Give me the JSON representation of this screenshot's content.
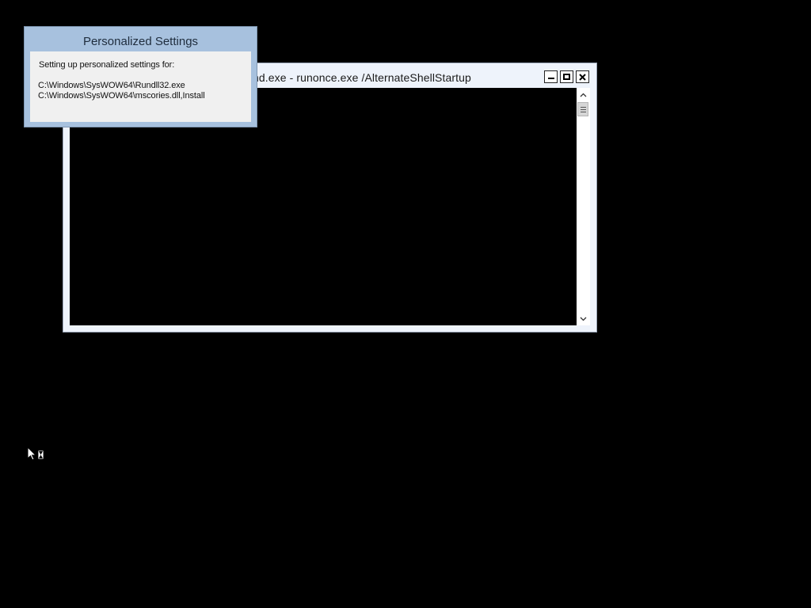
{
  "cmd_window": {
    "title": "cmd.exe - runonce.exe  /AlternateShellStartup",
    "caption_buttons": {
      "minimize": "minimize-icon",
      "maximize": "maximize-icon",
      "close": "close-icon"
    },
    "scrollbar": {
      "up_icon": "chevron-up-icon",
      "down_icon": "chevron-down-icon"
    }
  },
  "personalized_settings_dialog": {
    "title": "Personalized Settings",
    "intro": "Setting up personalized settings for:",
    "items": [
      "C:\\Windows\\SysWOW64\\Rundll32.exe",
      "C:\\Windows\\SysWOW64\\mscories.dll,Install"
    ]
  },
  "cursor": {
    "icon": "busy-cursor-icon"
  },
  "colors": {
    "desktop": "#000000",
    "dialog_frame": "#a7c1de",
    "dialog_body": "#f0f0f0",
    "window_frame": "#eef3fb"
  }
}
